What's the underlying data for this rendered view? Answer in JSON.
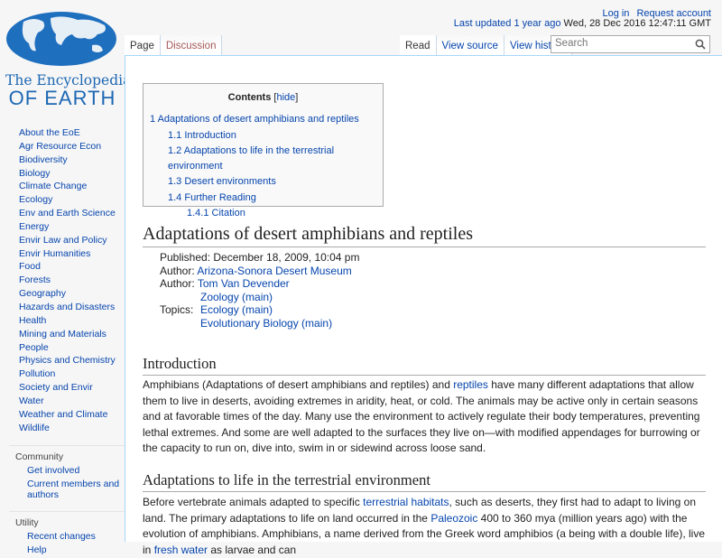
{
  "logo": {
    "line1": "The Encyclopedia",
    "line2": "OF EARTH"
  },
  "personal": {
    "login": "Log in",
    "request": "Request account"
  },
  "last_updated": {
    "label": "Last updated",
    "ago": "1 year ago",
    "date": "Wed, 28 Dec 2016 12:47:11 GMT"
  },
  "tabs_left": [
    "Page",
    "Discussion"
  ],
  "tabs_right": [
    "Read",
    "View source",
    "View history"
  ],
  "search": {
    "placeholder": "Search"
  },
  "sidebar": {
    "nav": [
      "About the EoE",
      "Agr Resource Econ",
      "Biodiversity",
      "Biology",
      "Climate Change",
      "Ecology",
      "Env and Earth Science",
      "Energy",
      "Envir Law and Policy",
      "Envir Humanities",
      "Food",
      "Forests",
      "Geography",
      "Hazards and Disasters",
      "Health",
      "Mining and Materials",
      "People",
      "Physics and Chemistry",
      "Pollution",
      "Society and Envir",
      "Water",
      "Weather and Climate",
      "Wildlife"
    ],
    "community": {
      "title": "Community",
      "items": [
        "Get involved",
        "Current members and authors"
      ]
    },
    "utility": {
      "title": "Utility",
      "items": [
        "Recent changes",
        "Help"
      ]
    }
  },
  "toc": {
    "title": "Contents",
    "hide": "hide",
    "items": [
      "1 Adaptations of desert amphibians and reptiles",
      "1.1 Introduction",
      "1.2 Adaptations to life in the terrestrial environment",
      "1.3 Desert environments",
      "1.4 Further Reading",
      "1.4.1 Citation"
    ]
  },
  "title": "Adaptations of desert amphibians and reptiles",
  "meta": {
    "published": "Published: December 18, 2009, 10:04 pm",
    "author_label": "Author:",
    "author1": "Arizona-Sonora Desert Museum",
    "author2": "Tom Van Devender",
    "topics_label": "Topics:",
    "topics": [
      "Zoology (main)",
      "Ecology (main)",
      "Evolutionary Biology (main)"
    ]
  },
  "sections": [
    {
      "heading": "Introduction",
      "para": [
        {
          "t": "Amphibians (Adaptations of desert amphibians and reptiles) and "
        },
        {
          "t": "reptiles",
          "link": true
        },
        {
          "t": " have many different adaptations that allow them to live in deserts, avoiding extremes in aridity, heat, or cold. The animals may be active only in certain seasons and at favorable times of the day. Many use the environment to actively regulate their body temperatures, preventing lethal extremes. And some are well adapted to the surfaces they live on—with modified appendages for burrowing or the capacity to run on, dive into, swim in or sidewind across loose sand."
        }
      ]
    },
    {
      "heading": "Adaptations to life in the terrestrial environment",
      "para": [
        {
          "t": "Before vertebrate animals adapted to specific "
        },
        {
          "t": "terrestrial habitats",
          "link": true
        },
        {
          "t": ", such as deserts, they first had to adapt to living on land. The primary adaptations to life on land occurred in the "
        },
        {
          "t": "Paleozoic",
          "link": true
        },
        {
          "t": " 400 to 360 mya (million years ago) with the evolution of amphibians. Amphibians, a name derived from the Greek word amphibios (a being with a double life), live in "
        },
        {
          "t": "fresh water",
          "link": true
        },
        {
          "t": " as larvae and can"
        }
      ]
    }
  ]
}
